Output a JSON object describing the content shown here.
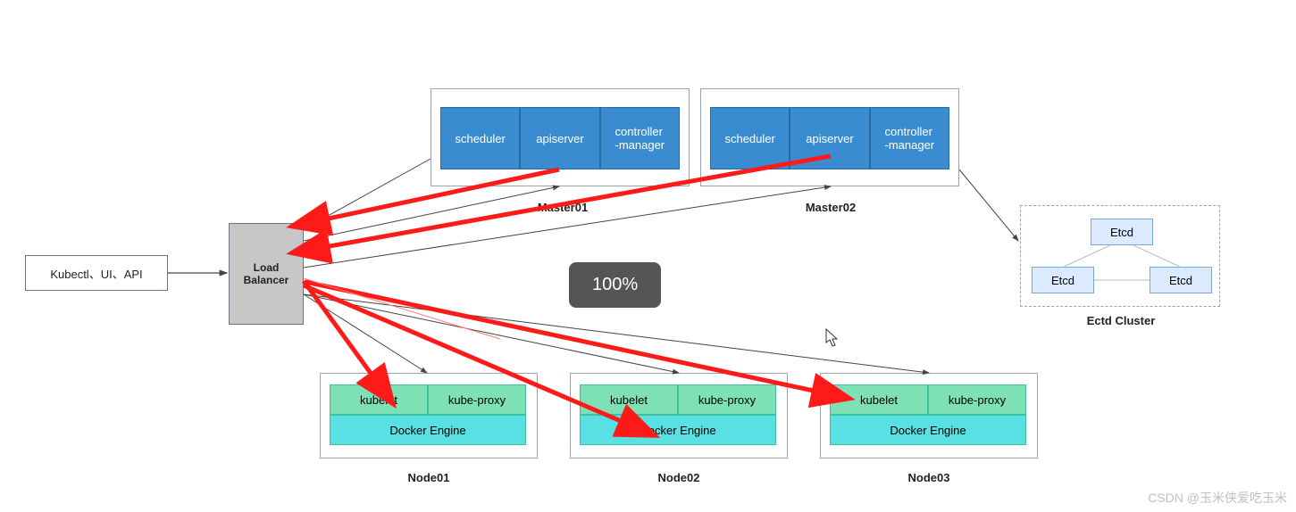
{
  "client": {
    "label": "Kubectl、UI、API"
  },
  "loadBalancer": {
    "line1": "Load",
    "line2": "Balancer"
  },
  "masters": [
    {
      "label": "Master01",
      "cells": [
        "scheduler",
        "apiserver",
        "controller\n-manager"
      ]
    },
    {
      "label": "Master02",
      "cells": [
        "scheduler",
        "apiserver",
        "controller\n-manager"
      ]
    }
  ],
  "nodes": [
    {
      "label": "Node01",
      "top": [
        "kubelet",
        "kube-proxy"
      ],
      "bottom": "Docker Engine"
    },
    {
      "label": "Node02",
      "top": [
        "kubelet",
        "kube-proxy"
      ],
      "bottom": "Docker Engine"
    },
    {
      "label": "Node03",
      "top": [
        "kubelet",
        "kube-proxy"
      ],
      "bottom": "Docker Engine"
    }
  ],
  "etcd": {
    "label": "Ectd Cluster",
    "items": [
      "Etcd",
      "Etcd",
      "Etcd"
    ]
  },
  "toast": "100%",
  "watermark": "CSDN @玉米侠爱吃玉米",
  "colors": {
    "master": "#3a8cd1",
    "nodeTop": "#7ee1b5",
    "nodeBot": "#58e0e4",
    "etcd": "#dbeafe",
    "lb": "#c7c7c7",
    "redArrow": "#ff1a1a"
  }
}
